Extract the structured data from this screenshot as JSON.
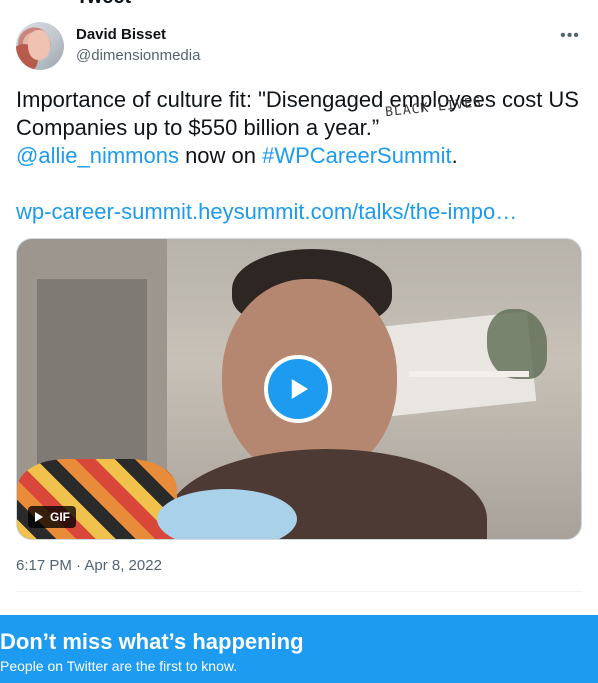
{
  "tweet": {
    "author_name": "David Bisset",
    "author_handle": "@dimensionmedia",
    "more_icon": "more-horizontal-icon",
    "text_main": "Importance of culture fit: \"Disengaged employees cost US Companies up to $550 billion a year.”",
    "mention": "@allie_nimmons",
    "text_mid": " now on ",
    "hashtag": "#WPCareerSummit",
    "text_end": ".",
    "url": "wp-career-summit.heysummit.com/talks/the-impo…",
    "media": {
      "sign_text": "BLACK LIVES",
      "gif_label": "GIF",
      "play_icon": "play-icon"
    },
    "timestamp": "6:17 PM · Apr 8, 2022"
  },
  "banner": {
    "title": "Don’t miss what’s happening",
    "subtitle": "People on Twitter are the first to know."
  },
  "colors": {
    "accent": "#1d9bf0",
    "text_primary": "#0f1419",
    "text_secondary": "#536471"
  }
}
